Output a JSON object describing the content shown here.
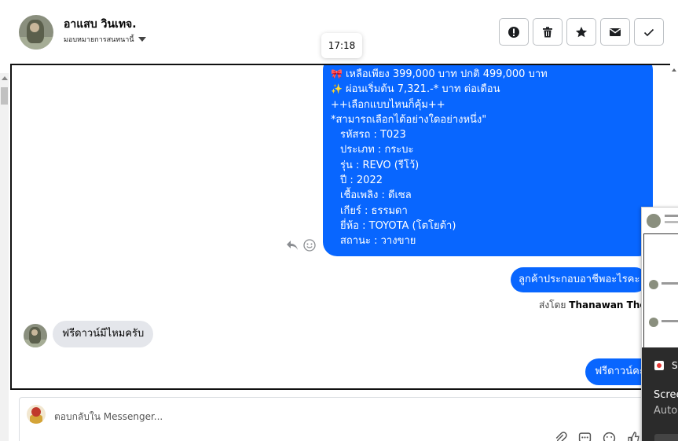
{
  "header": {
    "contact_name": "อาแสบ วินเทจ.",
    "assign_label": "มอบหมายการสนทนานี้"
  },
  "toolbar": {
    "buttons": [
      "alert-icon",
      "trash-icon",
      "star-icon",
      "mail-icon",
      "check-icon"
    ]
  },
  "tooltip_time": "17:18",
  "messages": {
    "car_listing": {
      "lines": [
        {
          "emoji": "🎀",
          "text": "เหลือเพียง 399,000 บาท ปกติ 499,000 บาท"
        },
        {
          "emoji": "✨",
          "text": "ผ่อนเริ่มต้น 7,321.-* บาท ต่อเดือน"
        },
        {
          "emoji": "",
          "text": "++เลือกแบบไหนก็คุ้ม++"
        },
        {
          "emoji": "",
          "text": "*สามารถเลือกได้อย่างใดอย่างหนึ่ง\""
        },
        {
          "emoji": "",
          "text": "รหัสรถ : T023"
        },
        {
          "emoji": "",
          "text": "ประเภท : กระบะ"
        },
        {
          "emoji": "",
          "text": "รุ่น : REVO (รีโว้)"
        },
        {
          "emoji": "",
          "text": "ปี : 2022"
        },
        {
          "emoji": "",
          "text": "เชื้อเพลิง : ดีเซล"
        },
        {
          "emoji": "",
          "text": "เกียร์ : ธรรมดา"
        },
        {
          "emoji": "",
          "text": "ยี่ห้อ : TOYOTA (โตโยต้า)"
        },
        {
          "emoji": "",
          "text": "สถานะ : วางขาย"
        }
      ]
    },
    "agent_question": "ลูกค้าประกอบอาชีพอะไรคะ",
    "sent_by_prefix": "ส่งโดย",
    "sent_by_name": "Thanawan Thon",
    "customer_msg": "ฟรีดาวน์มีไหมครับ",
    "agent_reply": "ฟรีดาวน์คะ"
  },
  "composer": {
    "placeholder": "ตอบกลับใน Messenger..."
  },
  "overlay": {
    "s_label": "S",
    "screen_label": "Scree",
    "auto_label": "Autor"
  }
}
